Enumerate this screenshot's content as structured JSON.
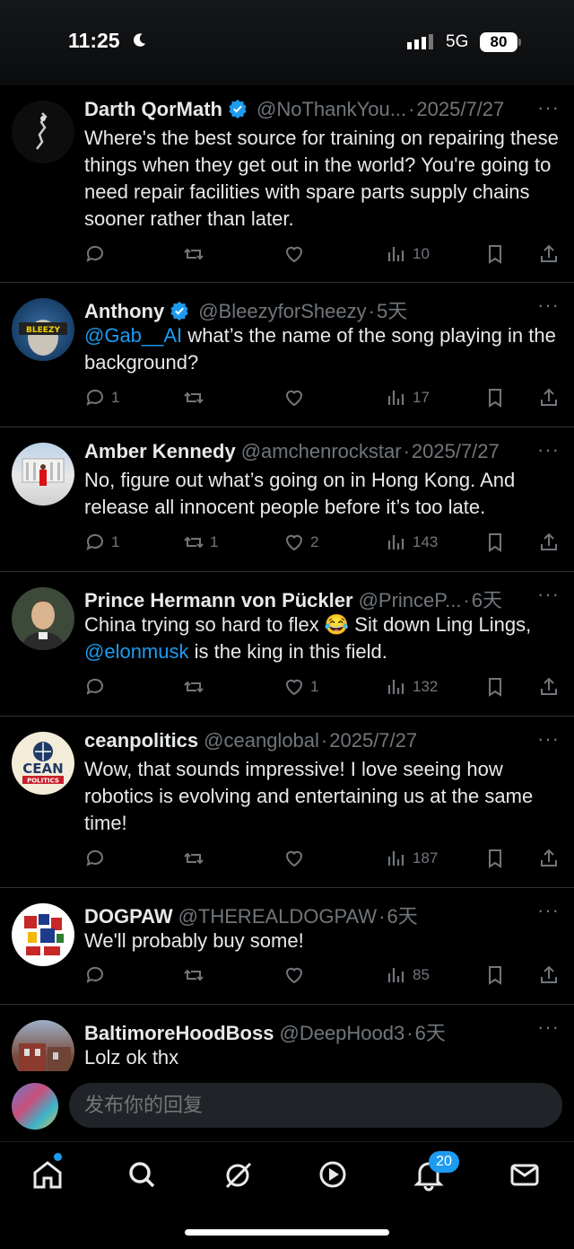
{
  "status": {
    "time": "11:25",
    "network": "5G",
    "battery": "80"
  },
  "tweets": [
    {
      "name": "Darth QorMath",
      "verified": true,
      "handle": "@NoThankYou...",
      "sep": "·",
      "date": "2025/7/27",
      "text_parts": [
        {
          "t": "Where's the best source for training on repairing these things when they get out in the world? You're going to need repair facilities with spare parts supply chains sooner rather than later.",
          "m": false
        }
      ],
      "replies": "",
      "retweets": "",
      "likes": "",
      "views": "10"
    },
    {
      "name": "Anthony",
      "verified": true,
      "handle": "@BleezyforSheezy",
      "sep": "·",
      "date": "5天",
      "text_parts": [
        {
          "t": "@Gab__AI",
          "m": true
        },
        {
          "t": " what’s the name of the song playing in the background?",
          "m": false
        }
      ],
      "replies": "1",
      "retweets": "",
      "likes": "",
      "views": "17"
    },
    {
      "name": "Amber Kennedy",
      "verified": false,
      "handle": "@amchenrockstar",
      "sep": "·",
      "date": "2025/7/27",
      "text_parts": [
        {
          "t": "No, figure out what’s going on in Hong Kong. And release all innocent people before it’s too late.",
          "m": false
        }
      ],
      "replies": "1",
      "retweets": "1",
      "likes": "2",
      "views": "143"
    },
    {
      "name": "Prince Hermann von Pückler",
      "verified": false,
      "handle": "@PrinceP...",
      "sep": "·",
      "date": "6天",
      "text_parts": [
        {
          "t": "China trying so hard to flex 😂 Sit down Ling Lings, ",
          "m": false
        },
        {
          "t": "@elonmusk",
          "m": true
        },
        {
          "t": " is the king in this field.",
          "m": false
        }
      ],
      "replies": "",
      "retweets": "",
      "likes": "1",
      "views": "132"
    },
    {
      "name": "ceanpolitics",
      "verified": false,
      "handle": "@ceanglobal",
      "sep": "·",
      "date": "2025/7/27",
      "text_parts": [
        {
          "t": "Wow, that sounds impressive! I love seeing how robotics is evolving and entertaining us at the same time!",
          "m": false
        }
      ],
      "replies": "",
      "retweets": "",
      "likes": "",
      "views": "187"
    },
    {
      "name": "DOGPAW",
      "verified": false,
      "handle": "@THEREALDOGPAW",
      "sep": "·",
      "date": "6天",
      "text_parts": [
        {
          "t": "We'll probably buy some!",
          "m": false
        }
      ],
      "replies": "",
      "retweets": "",
      "likes": "",
      "views": "85"
    },
    {
      "name": "BaltimoreHoodBoss",
      "verified": false,
      "handle": "@DeepHood3",
      "sep": "·",
      "date": "6天",
      "text_parts": [
        {
          "t": "Lolz ok thx",
          "m": false
        }
      ],
      "replies": "",
      "retweets": "",
      "likes": "",
      "views": ""
    }
  ],
  "avatar_labels": {
    "anthony": "BLEEZY",
    "cean_top": "CEAN",
    "cean_bottom": "POLITICS"
  },
  "more_label": "···",
  "reply_placeholder": "发布你的回复",
  "notifications_badge": "20",
  "colors": {
    "accent": "#1d9bf0",
    "muted": "#71767b",
    "text": "#e7e9ea"
  },
  "icons": [
    "reply-icon",
    "retweet-icon",
    "like-icon",
    "views-icon",
    "bookmark-icon",
    "share-icon",
    "home-icon",
    "search-icon",
    "grok-icon",
    "video-icon",
    "notifications-icon",
    "messages-icon"
  ]
}
